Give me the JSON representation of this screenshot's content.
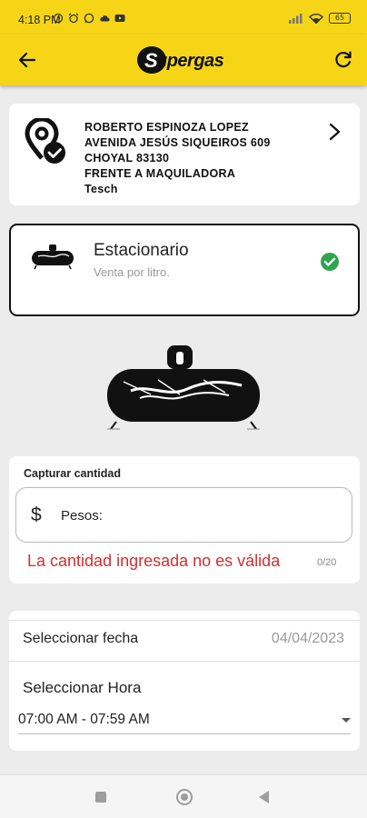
{
  "status_bar": {
    "time": "4:18 PM",
    "left_icons": [
      "clock-icon",
      "alarm-icon",
      "whatsapp-icon",
      "cloud-icon",
      "youtube-icon"
    ],
    "battery": "65",
    "right_icons": [
      "signal-icon",
      "wifi-icon",
      "battery-icon"
    ]
  },
  "app_bar": {
    "logo_text": "upergas",
    "logo_initial": "S",
    "back_icon": "arrow-back-icon",
    "refresh_icon": "refresh-icon",
    "background": "#f5d516"
  },
  "address": {
    "lines": [
      "ROBERTO ESPINOZA LOPEZ",
      "AVENIDA JESÚS SIQUEIROS 609",
      "CHOYAL 83130",
      "FRENTE A MAQUILADORA",
      "Tesch"
    ],
    "icon": "location-check-icon"
  },
  "tank_option": {
    "title": "Estacionario",
    "subtitle": "Venta por litro.",
    "selected": true,
    "check_color": "#2ea44f"
  },
  "quantity": {
    "label": "Capturar cantidad",
    "currency_symbol": "$",
    "field_label": "Pesos:",
    "error": "La cantidad ingresada no es válida",
    "counter": "0/20",
    "error_color": "#d32f2f"
  },
  "schedule": {
    "date_label": "Seleccionar fecha",
    "date_value": "04/04/2023",
    "hour_label": "Seleccionar Hora",
    "hour_value": "07:00 AM - 07:59 AM"
  }
}
